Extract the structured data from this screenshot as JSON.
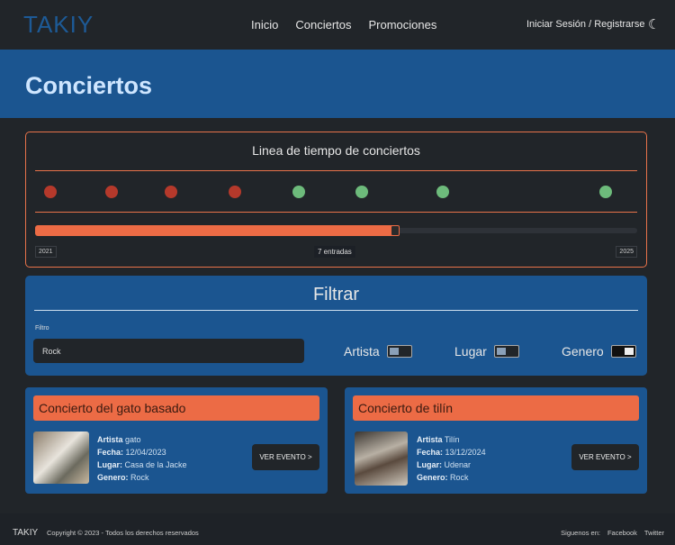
{
  "nav": {
    "logo": "TAKIY",
    "links": [
      "Inicio",
      "Conciertos",
      "Promociones"
    ],
    "auth": "Iniciar Sesión / Registrarse",
    "theme_icon": "moon-icon"
  },
  "banner": {
    "title": "Conciertos"
  },
  "timeline": {
    "title": "Linea de tiempo de conciertos",
    "dots": [
      "#b5392b",
      "#b5392b",
      "#b5392b",
      "#b5392b",
      "#6dbb7b",
      "#6dbb7b",
      "#6dbb7b",
      "#6dbb7b"
    ],
    "progress": 0.6,
    "start": "2021",
    "end": "2025",
    "entries": "7 entradas"
  },
  "filter": {
    "title": "Filtrar",
    "label": "Filtro",
    "value": "Rock",
    "toggles": [
      {
        "label": "Artista",
        "on": false
      },
      {
        "label": "Lugar",
        "on": false
      },
      {
        "label": "Genero",
        "on": true
      }
    ]
  },
  "cards": [
    {
      "title": "Concierto del gato basado",
      "artista_label": "Artista",
      "artista": "gato",
      "fecha_label": "Fecha:",
      "fecha": "12/04/2023",
      "lugar_label": "Lugar:",
      "lugar": "Casa de la Jacke",
      "genero_label": "Genero:",
      "genero": "Rock",
      "button": "VER EVENTO >"
    },
    {
      "title": "Concierto de tilín",
      "artista_label": "Artista",
      "artista": "Tilín",
      "fecha_label": "Fecha:",
      "fecha": "13/12/2024",
      "lugar_label": "Lugar:",
      "lugar": "Udenar",
      "genero_label": "Genero:",
      "genero": "Rock",
      "button": "VER EVENTO >"
    }
  ],
  "footer": {
    "logo": "TAKIY",
    "copyright": "Copyright © 2023 - Todos los derechos reservados",
    "follow": "Siguenos en:",
    "links": [
      "Facebook",
      "Twitter"
    ]
  }
}
